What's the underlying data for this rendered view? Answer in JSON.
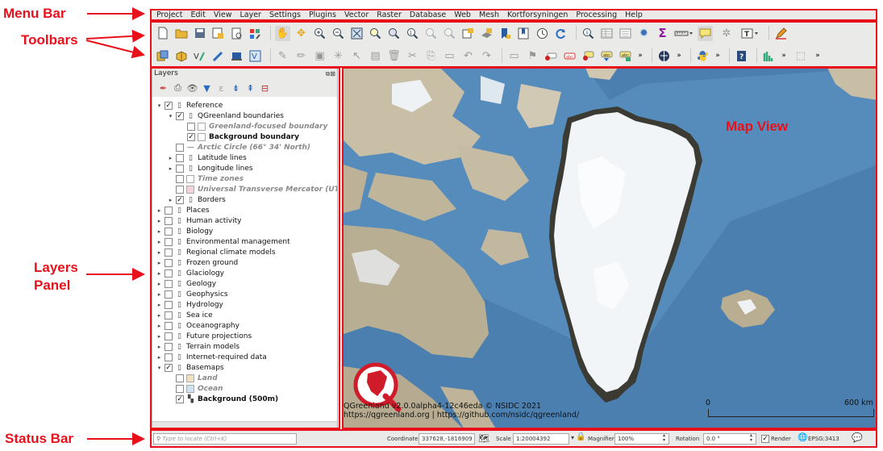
{
  "annotations": {
    "menu_bar": "Menu Bar",
    "toolbars": "Toolbars",
    "layers_panel_line1": "Layers",
    "layers_panel_line2": "Panel",
    "map_view": "Map View",
    "status_bar": "Status Bar"
  },
  "menu": [
    "Project",
    "Edit",
    "View",
    "Layer",
    "Settings",
    "Plugins",
    "Vector",
    "Raster",
    "Database",
    "Web",
    "Mesh",
    "Kortforsyningen",
    "Processing",
    "Help"
  ],
  "layers_panel": {
    "title": "Layers",
    "tree": [
      {
        "label": "Reference",
        "level": 0,
        "expand": "▾",
        "checked": true,
        "icon": "group",
        "style": "normal"
      },
      {
        "label": "QGreenland boundaries",
        "level": 1,
        "expand": "▾",
        "checked": true,
        "icon": "group",
        "style": "normal"
      },
      {
        "label": "Greenland-focused boundary",
        "level": 2,
        "expand": "",
        "checked": false,
        "icon": "polygon",
        "style": "italic"
      },
      {
        "label": "Background boundary",
        "level": 2,
        "expand": "",
        "checked": true,
        "icon": "polygon",
        "style": "bold"
      },
      {
        "label": "Arctic Circle (66° 34' North)",
        "level": 1,
        "expand": "",
        "checked": false,
        "icon": "line",
        "style": "italic"
      },
      {
        "label": "Latitude lines",
        "level": 1,
        "expand": "▸",
        "checked": false,
        "icon": "group",
        "style": "normal"
      },
      {
        "label": "Longitude lines",
        "level": 1,
        "expand": "▸",
        "checked": false,
        "icon": "group",
        "style": "normal"
      },
      {
        "label": "Time zones",
        "level": 1,
        "expand": "",
        "checked": false,
        "icon": "polygon",
        "style": "italic"
      },
      {
        "label": "Universal Transverse Mercator (UTM",
        "level": 1,
        "expand": "",
        "checked": false,
        "icon": "pink",
        "style": "italic"
      },
      {
        "label": "Borders",
        "level": 1,
        "expand": "▸",
        "checked": true,
        "icon": "group",
        "style": "normal"
      },
      {
        "label": "Places",
        "level": 0,
        "expand": "▸",
        "checked": false,
        "icon": "group",
        "style": "normal"
      },
      {
        "label": "Human activity",
        "level": 0,
        "expand": "▸",
        "checked": false,
        "icon": "group",
        "style": "normal"
      },
      {
        "label": "Biology",
        "level": 0,
        "expand": "▸",
        "checked": false,
        "icon": "group",
        "style": "normal"
      },
      {
        "label": "Environmental management",
        "level": 0,
        "expand": "▸",
        "checked": false,
        "icon": "group",
        "style": "normal"
      },
      {
        "label": "Regional climate models",
        "level": 0,
        "expand": "▸",
        "checked": false,
        "icon": "group",
        "style": "normal"
      },
      {
        "label": "Frozen ground",
        "level": 0,
        "expand": "▸",
        "checked": false,
        "icon": "group",
        "style": "normal"
      },
      {
        "label": "Glaciology",
        "level": 0,
        "expand": "▸",
        "checked": false,
        "icon": "group",
        "style": "normal"
      },
      {
        "label": "Geology",
        "level": 0,
        "expand": "▸",
        "checked": false,
        "icon": "group",
        "style": "normal"
      },
      {
        "label": "Geophysics",
        "level": 0,
        "expand": "▸",
        "checked": false,
        "icon": "group",
        "style": "normal"
      },
      {
        "label": "Hydrology",
        "level": 0,
        "expand": "▸",
        "checked": false,
        "icon": "group",
        "style": "normal"
      },
      {
        "label": "Sea ice",
        "level": 0,
        "expand": "▸",
        "checked": false,
        "icon": "group",
        "style": "normal"
      },
      {
        "label": "Oceanography",
        "level": 0,
        "expand": "▸",
        "checked": false,
        "icon": "group",
        "style": "normal"
      },
      {
        "label": "Future projections",
        "level": 0,
        "expand": "▸",
        "checked": false,
        "icon": "group",
        "style": "normal"
      },
      {
        "label": "Terrain models",
        "level": 0,
        "expand": "▸",
        "checked": false,
        "icon": "group",
        "style": "normal"
      },
      {
        "label": "Internet-required data",
        "level": 0,
        "expand": "▸",
        "checked": false,
        "icon": "group",
        "style": "normal"
      },
      {
        "label": "Basemaps",
        "level": 0,
        "expand": "▾",
        "checked": true,
        "icon": "group",
        "style": "normal"
      },
      {
        "label": "Land",
        "level": 1,
        "expand": "",
        "checked": false,
        "icon": "land",
        "style": "italic"
      },
      {
        "label": "Ocean",
        "level": 1,
        "expand": "",
        "checked": false,
        "icon": "ocean",
        "style": "italic"
      },
      {
        "label": "Background (500m)",
        "level": 1,
        "expand": "",
        "checked": true,
        "icon": "raster",
        "style": "bold"
      }
    ]
  },
  "map": {
    "attribution_line1": "QGreenland v2.0.0alpha4-12c46eda © NSIDC 2021",
    "attribution_line2": "https://qgreenland.org | https://github.com/nsidc/qgreenland/",
    "scale_start": "0",
    "scale_end": "600 km"
  },
  "status": {
    "locate_placeholder": "Type to locate (Ctrl+K)",
    "coordinate_label": "Coordinate",
    "coordinate_value": "337628,-1816909",
    "scale_label": "Scale",
    "scale_value": "1:20004392",
    "magnifier_label": "Magnifier",
    "magnifier_value": "100%",
    "rotation_label": "Rotation",
    "rotation_value": "0.0 °",
    "render_label": "Render",
    "crs": "EPSG:3413"
  },
  "colors": {
    "annotation": "#e8111b",
    "ocean": "#4a7fb0",
    "ice": "#f2f5f8",
    "land": "#b8a98c"
  }
}
